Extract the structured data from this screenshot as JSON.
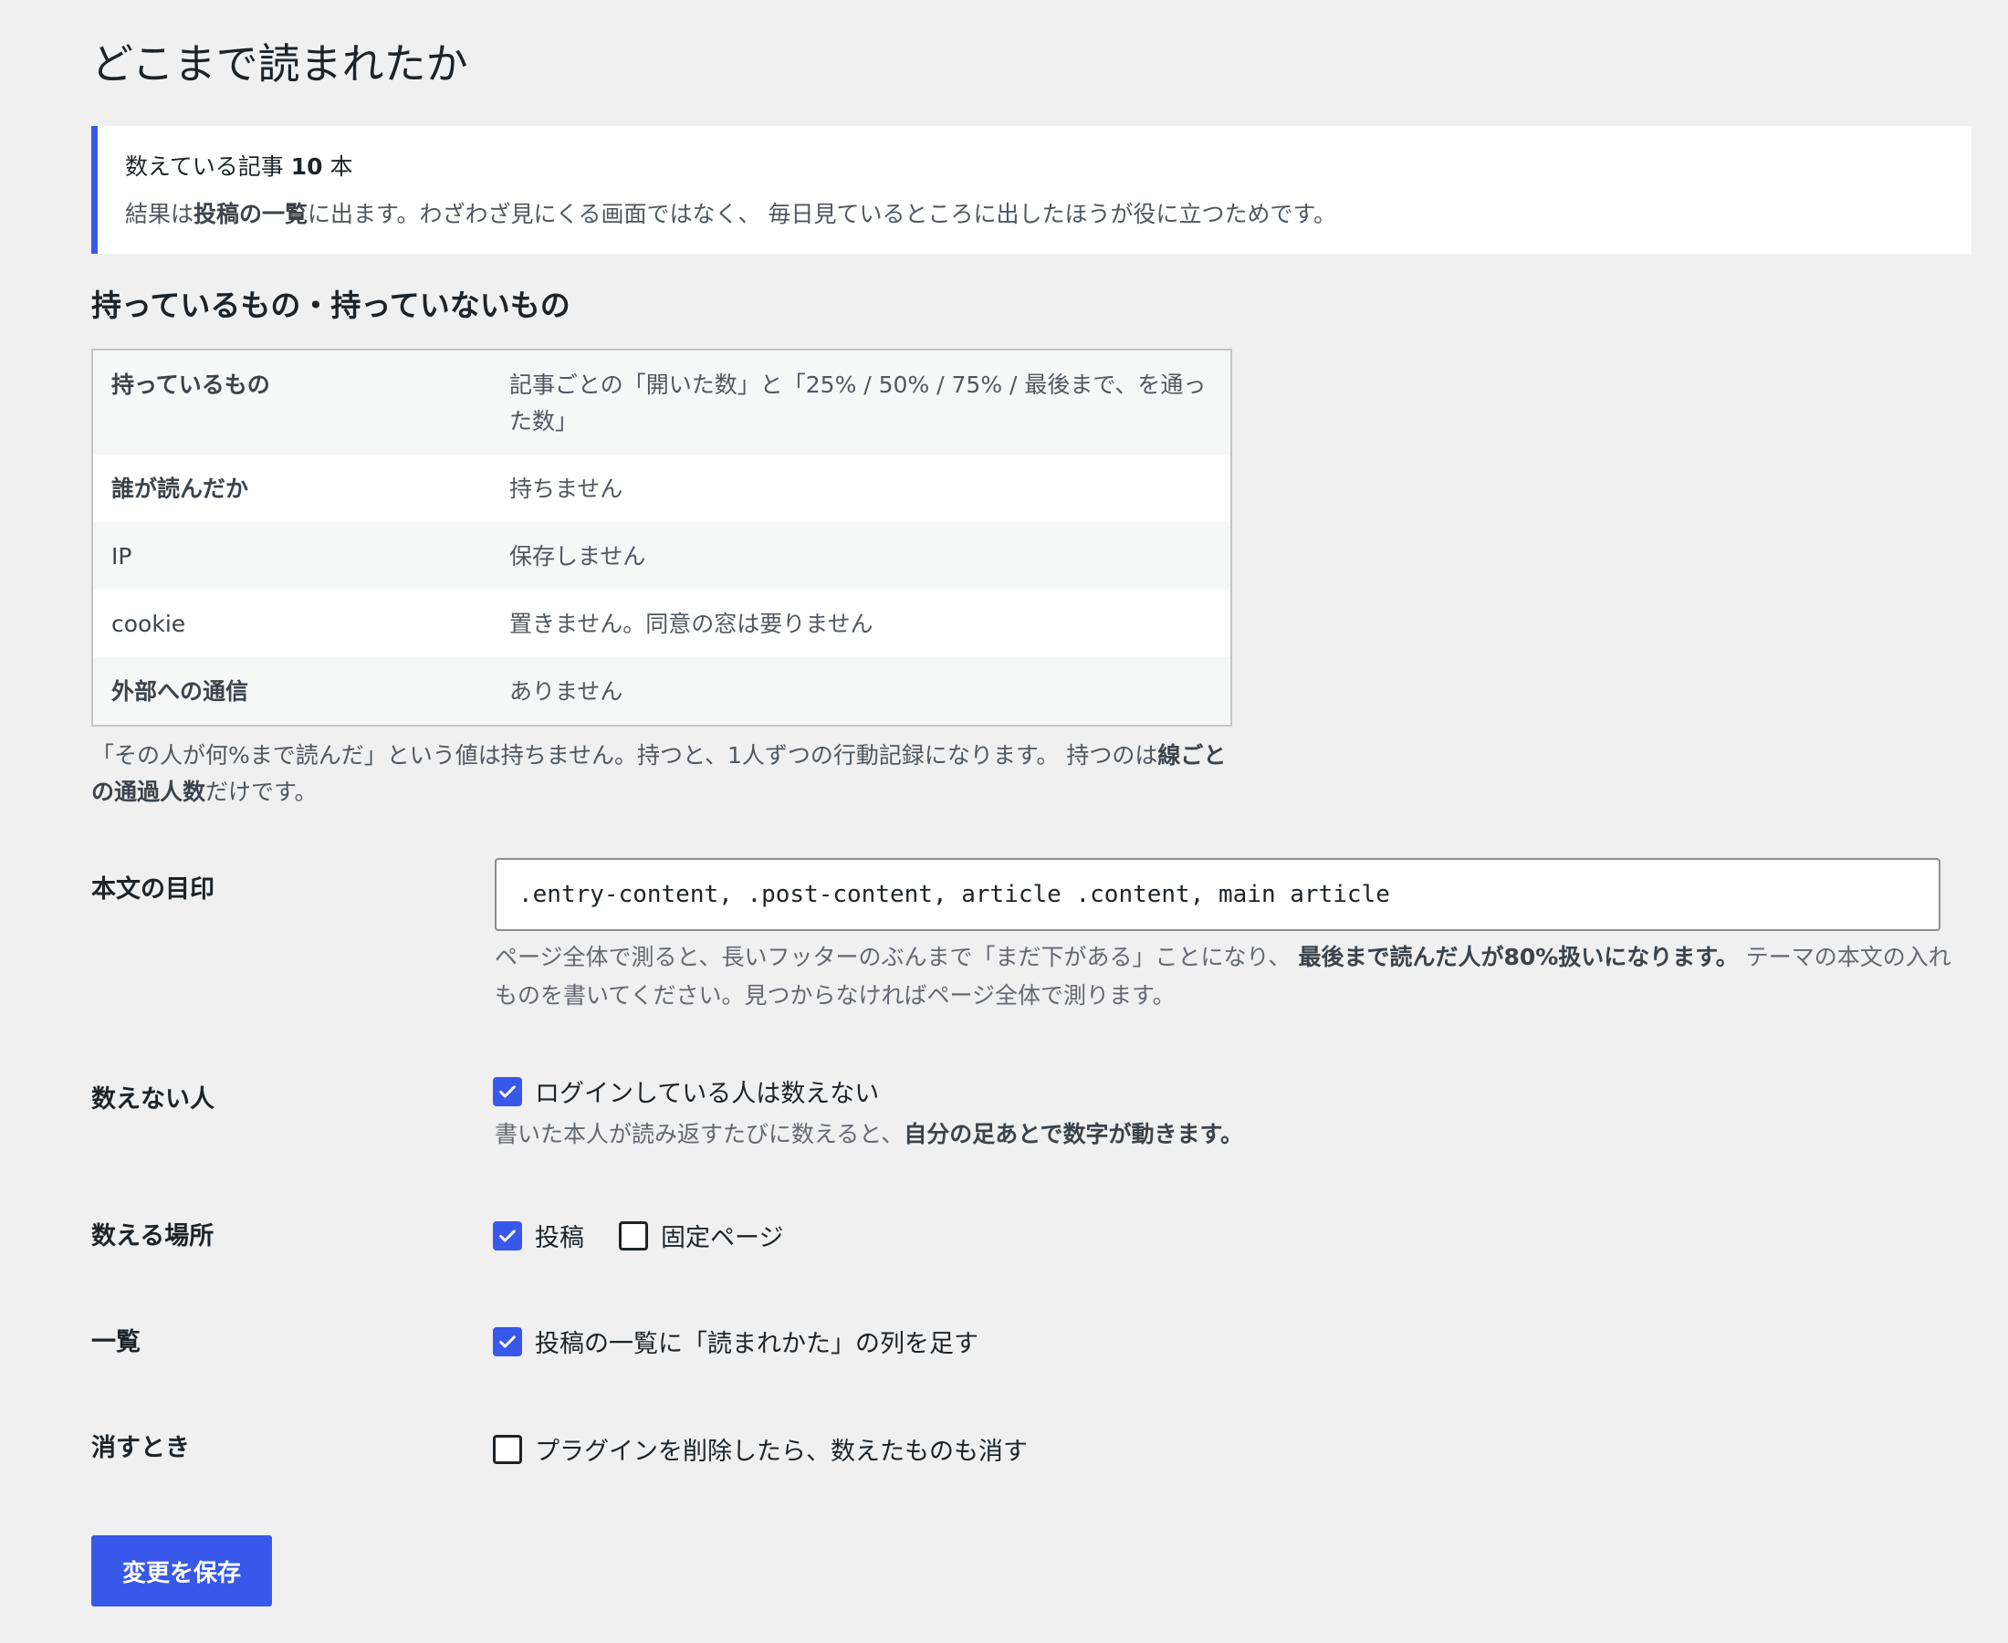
{
  "page": {
    "title": "どこまで読まれたか"
  },
  "notice": {
    "count_prefix": "数えている記事 ",
    "count": "10",
    "count_suffix": " 本",
    "desc_pre": "結果は",
    "desc_bold": "投稿の一覧",
    "desc_post": "に出ます。わざわざ見にくる画面ではなく、 毎日見ているところに出したほうが役に立つためです。"
  },
  "data_section": {
    "heading": "持っているもの・持っていないもの",
    "rows": [
      {
        "key": "持っているもの",
        "value": "記事ごとの「開いた数」と「25% / 50% / 75% / 最後まで、を通った数」"
      },
      {
        "key": "誰が読んだか",
        "value": "持ちません"
      },
      {
        "key": "IP",
        "value": "保存しません"
      },
      {
        "key": "cookie",
        "value": "置きません。同意の窓は要りません"
      },
      {
        "key": "外部への通信",
        "value": "ありません"
      }
    ],
    "note_pre": "「その人が何%まで読んだ」という値は持ちません。持つと、1人ずつの行動記録になります。 持つのは",
    "note_bold": "線ごとの通過人数",
    "note_post": "だけです。"
  },
  "settings": {
    "content_selector": {
      "label": "本文の目印",
      "value": ".entry-content, .post-content, article .content, main article",
      "help_pre": "ページ全体で測ると、長いフッターのぶんまで「まだ下がある」ことになり、 ",
      "help_bold": "最後まで読んだ人が80%扱いになります。",
      "help_post": " テーマの本文の入れものを書いてください。見つからなければページ全体で測ります。"
    },
    "exclude": {
      "label": "数えない人",
      "checkbox_label": "ログインしている人は数えない",
      "checked": true,
      "help_pre": "書いた本人が読み返すたびに数えると、",
      "help_bold": "自分の足あとで数字が動きます。"
    },
    "locations": {
      "label": "数える場所",
      "options": [
        {
          "label": "投稿",
          "checked": true
        },
        {
          "label": "固定ページ",
          "checked": false
        }
      ]
    },
    "list": {
      "label": "一覧",
      "checkbox_label": "投稿の一覧に「読まれかた」の列を足す",
      "checked": true
    },
    "uninstall": {
      "label": "消すとき",
      "checkbox_label": "プラグインを削除したら、数えたものも消す",
      "checked": false
    }
  },
  "save_button": {
    "label": "変更を保存"
  },
  "colors": {
    "accent": "#3858e9",
    "background": "#f0f0f1"
  },
  "icons": {
    "checkbox_checked": "checkmark-icon"
  }
}
